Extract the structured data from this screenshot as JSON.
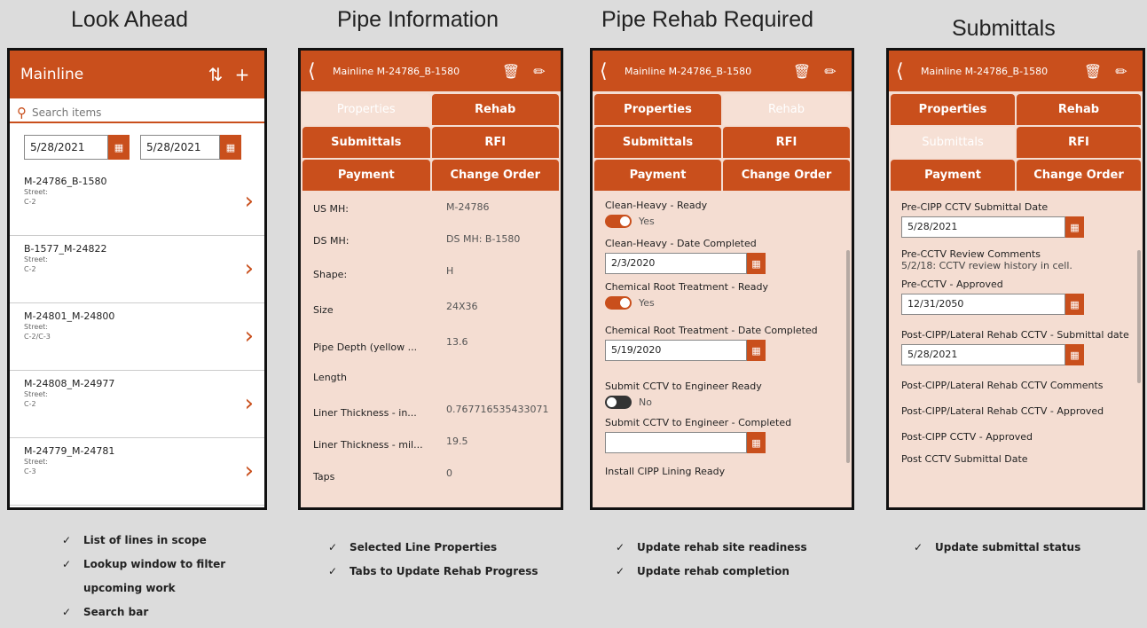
{
  "titles": [
    "Look Ahead",
    "Pipe Information",
    "Pipe Rehab Required",
    "Submittals"
  ],
  "screen1": {
    "title": "Mainline",
    "search_placeholder": "Search items",
    "date_from": "5/28/2021",
    "date_to": "5/28/2021",
    "items": [
      {
        "name": "M-24786_B-1580",
        "street": "Street:",
        "code": "C-2"
      },
      {
        "name": "B-1577_M-24822",
        "street": "Street:",
        "code": "C-2"
      },
      {
        "name": "M-24801_M-24800",
        "street": "Street:",
        "code": "C-2/C-3"
      },
      {
        "name": "M-24808_M-24977",
        "street": "Street:",
        "code": "C-2"
      },
      {
        "name": "M-24779_M-24781",
        "street": "Street:",
        "code": "C-3"
      }
    ]
  },
  "header": {
    "title": "Mainline M-24786_B-1580"
  },
  "tabs": [
    "Properties",
    "Rehab",
    "Submittals",
    "RFI",
    "Payment",
    "Change Order"
  ],
  "screen2": {
    "rows": [
      {
        "k": "US MH:",
        "v": "M-24786"
      },
      {
        "k": "DS MH:",
        "v": "DS MH: B-1580"
      },
      {
        "k": "Shape:",
        "v": "H"
      },
      {
        "k": "Size",
        "v": "24X36"
      },
      {
        "k": "Pipe Depth (yellow ...",
        "v": "13.6"
      },
      {
        "k": "Length",
        "v": ""
      },
      {
        "k": "Liner Thickness - in...",
        "v": "0.767716535433071"
      },
      {
        "k": "Liner Thickness - mil...",
        "v": "19.5"
      },
      {
        "k": "Taps",
        "v": "0"
      }
    ]
  },
  "screen3": {
    "f1": "Clean-Heavy - Ready",
    "t1": "Yes",
    "f2": "Clean-Heavy - Date Completed",
    "d2": "2/3/2020",
    "f3": "Chemical Root Treatment - Ready",
    "t3": "Yes",
    "f4": "Chemical Root Treatment - Date Completed",
    "d4": "5/19/2020",
    "f5": "Submit CCTV to Engineer Ready",
    "t5": "No",
    "f6": "Submit CCTV to Engineer - Completed",
    "d6": "",
    "f7": "Install CIPP Lining Ready"
  },
  "screen4": {
    "f1": "Pre-CIPP CCTV Submittal Date",
    "d1": "5/28/2021",
    "f2": "Pre-CCTV Review Comments",
    "c2": "5/2/18:  CCTV review history in cell.",
    "f3": "Pre-CCTV - Approved",
    "d3": "12/31/2050",
    "f4": "Post-CIPP/Lateral Rehab CCTV - Submittal date",
    "d4": "5/28/2021",
    "f5": "Post-CIPP/Lateral Rehab CCTV Comments",
    "f6": "Post-CIPP/Lateral Rehab CCTV - Approved",
    "f7": "Post-CIPP CCTV - Approved",
    "f8": "Post CCTV Submittal Date"
  },
  "bullets1": [
    "List of lines in scope",
    "Lookup window to filter",
    "upcoming work",
    "Search bar"
  ],
  "bullets2": [
    "Selected Line Properties",
    "Tabs to Update Rehab Progress"
  ],
  "bullets3": [
    "Update rehab site readiness",
    "Update rehab completion"
  ],
  "bullets4": [
    "Update submittal status"
  ]
}
